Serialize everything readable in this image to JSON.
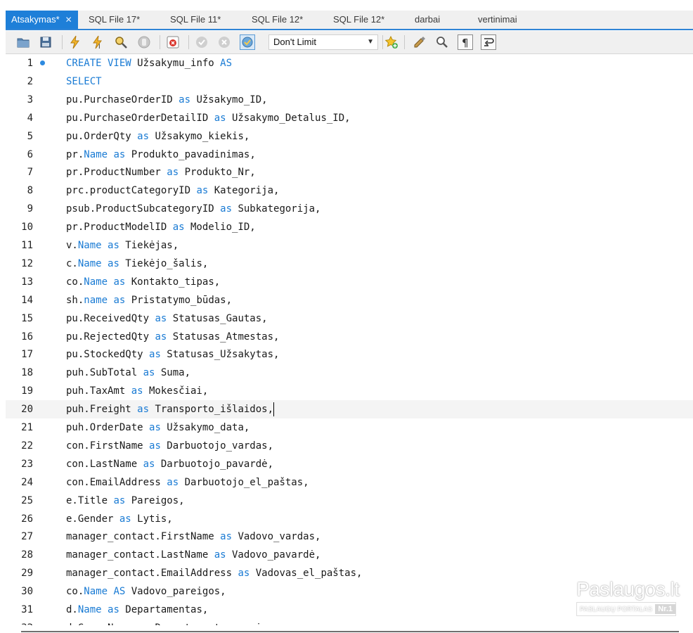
{
  "tabs": [
    {
      "label": "Atsakymas*",
      "active": true,
      "close": "✕"
    },
    {
      "label": "SQL File 17*"
    },
    {
      "label": "SQL File 11*"
    },
    {
      "label": "SQL File 12*"
    },
    {
      "label": "SQL File 12*"
    },
    {
      "label": "darbai"
    },
    {
      "label": "vertinimai"
    }
  ],
  "toolbar": {
    "limit_select": "Don't Limit",
    "icons": [
      "open-folder-icon",
      "save-icon",
      "execute-icon",
      "execute-current-icon",
      "explain-icon",
      "stop-icon",
      "toggle-error-icon",
      "commit-icon",
      "rollback-icon",
      "autocommit-icon",
      "bookmark-icon",
      "beautify-icon",
      "find-icon",
      "invisible-chars-icon",
      "wrap-icon"
    ]
  },
  "editor": {
    "current_line": 20,
    "lines": [
      {
        "n": "1",
        "marker": true,
        "tokens": [
          {
            "t": "CREATE VIEW ",
            "k": true
          },
          {
            "t": "Užsakymu_info "
          },
          {
            "t": "AS",
            "k": true
          }
        ]
      },
      {
        "n": "2",
        "tokens": [
          {
            "t": "SELECT",
            "k": true
          }
        ]
      },
      {
        "n": "3",
        "tokens": [
          {
            "t": "pu.PurchaseOrderID "
          },
          {
            "t": "as",
            "k": true
          },
          {
            "t": " Užsakymo_ID,"
          }
        ]
      },
      {
        "n": "4",
        "tokens": [
          {
            "t": "pu.PurchaseOrderDetailID "
          },
          {
            "t": "as",
            "k": true
          },
          {
            "t": " Užsakymo_Detalus_ID,"
          }
        ]
      },
      {
        "n": "5",
        "tokens": [
          {
            "t": "pu.OrderQty "
          },
          {
            "t": "as",
            "k": true
          },
          {
            "t": " Užsakymo_kiekis,"
          }
        ]
      },
      {
        "n": "6",
        "tokens": [
          {
            "t": "pr."
          },
          {
            "t": "Name",
            "k": true
          },
          {
            "t": " "
          },
          {
            "t": "as",
            "k": true
          },
          {
            "t": " Produkto_pavadinimas,"
          }
        ]
      },
      {
        "n": "7",
        "tokens": [
          {
            "t": "pr.ProductNumber "
          },
          {
            "t": "as",
            "k": true
          },
          {
            "t": " Produkto_Nr,"
          }
        ]
      },
      {
        "n": "8",
        "tokens": [
          {
            "t": "prc.productCategoryID "
          },
          {
            "t": "as",
            "k": true
          },
          {
            "t": " Kategorija,"
          }
        ]
      },
      {
        "n": "9",
        "tokens": [
          {
            "t": "psub.ProductSubcategoryID "
          },
          {
            "t": "as",
            "k": true
          },
          {
            "t": " Subkategorija,"
          }
        ]
      },
      {
        "n": "10",
        "tokens": [
          {
            "t": "pr.ProductModelID "
          },
          {
            "t": "as",
            "k": true
          },
          {
            "t": " Modelio_ID,"
          }
        ]
      },
      {
        "n": "11",
        "tokens": [
          {
            "t": "v."
          },
          {
            "t": "Name",
            "k": true
          },
          {
            "t": " "
          },
          {
            "t": "as",
            "k": true
          },
          {
            "t": " Tiekėjas,"
          }
        ]
      },
      {
        "n": "12",
        "tokens": [
          {
            "t": "c."
          },
          {
            "t": "Name",
            "k": true
          },
          {
            "t": " "
          },
          {
            "t": "as",
            "k": true
          },
          {
            "t": " Tiekėjo_šalis,"
          }
        ]
      },
      {
        "n": "13",
        "tokens": [
          {
            "t": "co."
          },
          {
            "t": "Name",
            "k": true
          },
          {
            "t": " "
          },
          {
            "t": "as",
            "k": true
          },
          {
            "t": " Kontakto_tipas,"
          }
        ]
      },
      {
        "n": "14",
        "tokens": [
          {
            "t": "sh."
          },
          {
            "t": "name",
            "k": true
          },
          {
            "t": " "
          },
          {
            "t": "as",
            "k": true
          },
          {
            "t": " Pristatymo_būdas,"
          }
        ]
      },
      {
        "n": "15",
        "tokens": [
          {
            "t": "pu.ReceivedQty "
          },
          {
            "t": "as",
            "k": true
          },
          {
            "t": " Statusas_Gautas,"
          }
        ]
      },
      {
        "n": "16",
        "tokens": [
          {
            "t": "pu.RejectedQty "
          },
          {
            "t": "as",
            "k": true
          },
          {
            "t": " Statusas_Atmestas,"
          }
        ]
      },
      {
        "n": "17",
        "tokens": [
          {
            "t": "pu.StockedQty "
          },
          {
            "t": "as",
            "k": true
          },
          {
            "t": " Statusas_Užsakytas,"
          }
        ]
      },
      {
        "n": "18",
        "tokens": [
          {
            "t": "puh.SubTotal "
          },
          {
            "t": "as",
            "k": true
          },
          {
            "t": " Suma,"
          }
        ]
      },
      {
        "n": "19",
        "tokens": [
          {
            "t": "puh.TaxAmt "
          },
          {
            "t": "as",
            "k": true
          },
          {
            "t": " Mokesčiai,"
          }
        ]
      },
      {
        "n": "20",
        "tokens": [
          {
            "t": "puh.Freight "
          },
          {
            "t": "as",
            "k": true
          },
          {
            "t": " Transporto_išlaidos,"
          }
        ]
      },
      {
        "n": "21",
        "tokens": [
          {
            "t": "puh.OrderDate "
          },
          {
            "t": "as",
            "k": true
          },
          {
            "t": " Užsakymo_data,"
          }
        ]
      },
      {
        "n": "22",
        "tokens": [
          {
            "t": "con.FirstName "
          },
          {
            "t": "as",
            "k": true
          },
          {
            "t": " Darbuotojo_vardas,"
          }
        ]
      },
      {
        "n": "23",
        "tokens": [
          {
            "t": "con.LastName "
          },
          {
            "t": "as",
            "k": true
          },
          {
            "t": " Darbuotojo_pavardė,"
          }
        ]
      },
      {
        "n": "24",
        "tokens": [
          {
            "t": "con.EmailAddress "
          },
          {
            "t": "as",
            "k": true
          },
          {
            "t": " Darbuotojo_el_paštas,"
          }
        ]
      },
      {
        "n": "25",
        "tokens": [
          {
            "t": "e.Title "
          },
          {
            "t": "as",
            "k": true
          },
          {
            "t": " Pareigos,"
          }
        ]
      },
      {
        "n": "26",
        "tokens": [
          {
            "t": "e.Gender "
          },
          {
            "t": "as",
            "k": true
          },
          {
            "t": " Lytis,"
          }
        ]
      },
      {
        "n": "27",
        "tokens": [
          {
            "t": "manager_contact.FirstName "
          },
          {
            "t": "as",
            "k": true
          },
          {
            "t": " Vadovo_vardas,"
          }
        ]
      },
      {
        "n": "28",
        "tokens": [
          {
            "t": "manager_contact.LastName "
          },
          {
            "t": "as",
            "k": true
          },
          {
            "t": " Vadovo_pavardė,"
          }
        ]
      },
      {
        "n": "29",
        "tokens": [
          {
            "t": "manager_contact.EmailAddress "
          },
          {
            "t": "as",
            "k": true
          },
          {
            "t": " Vadovas_el_paštas,"
          }
        ]
      },
      {
        "n": "30",
        "tokens": [
          {
            "t": "co."
          },
          {
            "t": "Name",
            "k": true
          },
          {
            "t": " "
          },
          {
            "t": "AS",
            "k": true
          },
          {
            "t": " Vadovo_pareigos,"
          }
        ]
      },
      {
        "n": "31",
        "tokens": [
          {
            "t": "d."
          },
          {
            "t": "Name",
            "k": true
          },
          {
            "t": " "
          },
          {
            "t": "as",
            "k": true
          },
          {
            "t": " Departamentas,"
          }
        ]
      },
      {
        "n": "32",
        "tokens": [
          {
            "t": "d.GroupName "
          },
          {
            "t": "as",
            "k": true
          },
          {
            "t": " Departamento_grupė,"
          }
        ]
      }
    ]
  },
  "watermark": {
    "brand": "Paslaugos.lt",
    "sub": "PASLAUGŲ PORTALAS",
    "badge": "Nr.1"
  },
  "colors": {
    "accent": "#1e7fd8",
    "keyword": "#1a7bd4",
    "toolbar_bg": "#f0f0f0"
  }
}
